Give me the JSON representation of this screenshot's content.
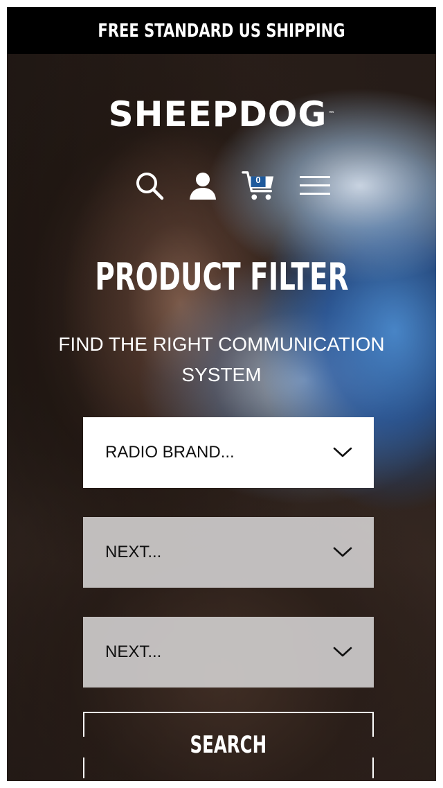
{
  "announcement": {
    "text": "FREE STANDARD US SHIPPING"
  },
  "header": {
    "logo_text": "SHEEPDOG",
    "logo_tm": "™",
    "icons": {
      "search": "search-icon",
      "account": "user-icon",
      "cart": "cart-icon",
      "menu": "hamburger-menu-icon"
    },
    "cart_count": "0"
  },
  "hero": {
    "title": "PRODUCT FILTER",
    "subtitle": "FIND THE RIGHT COMMUNICATION SYSTEM"
  },
  "filter": {
    "selects": [
      {
        "label": "RADIO BRAND..."
      },
      {
        "label": "NEXT..."
      },
      {
        "label": "NEXT..."
      }
    ],
    "search_label": "SEARCH"
  },
  "colors": {
    "announcement_bg": "#000000",
    "text_light": "#ffffff",
    "select_active_bg": "#ffffff",
    "select_disabled_bg": "#cecccc",
    "cart_badge": "#1f5a9c"
  }
}
